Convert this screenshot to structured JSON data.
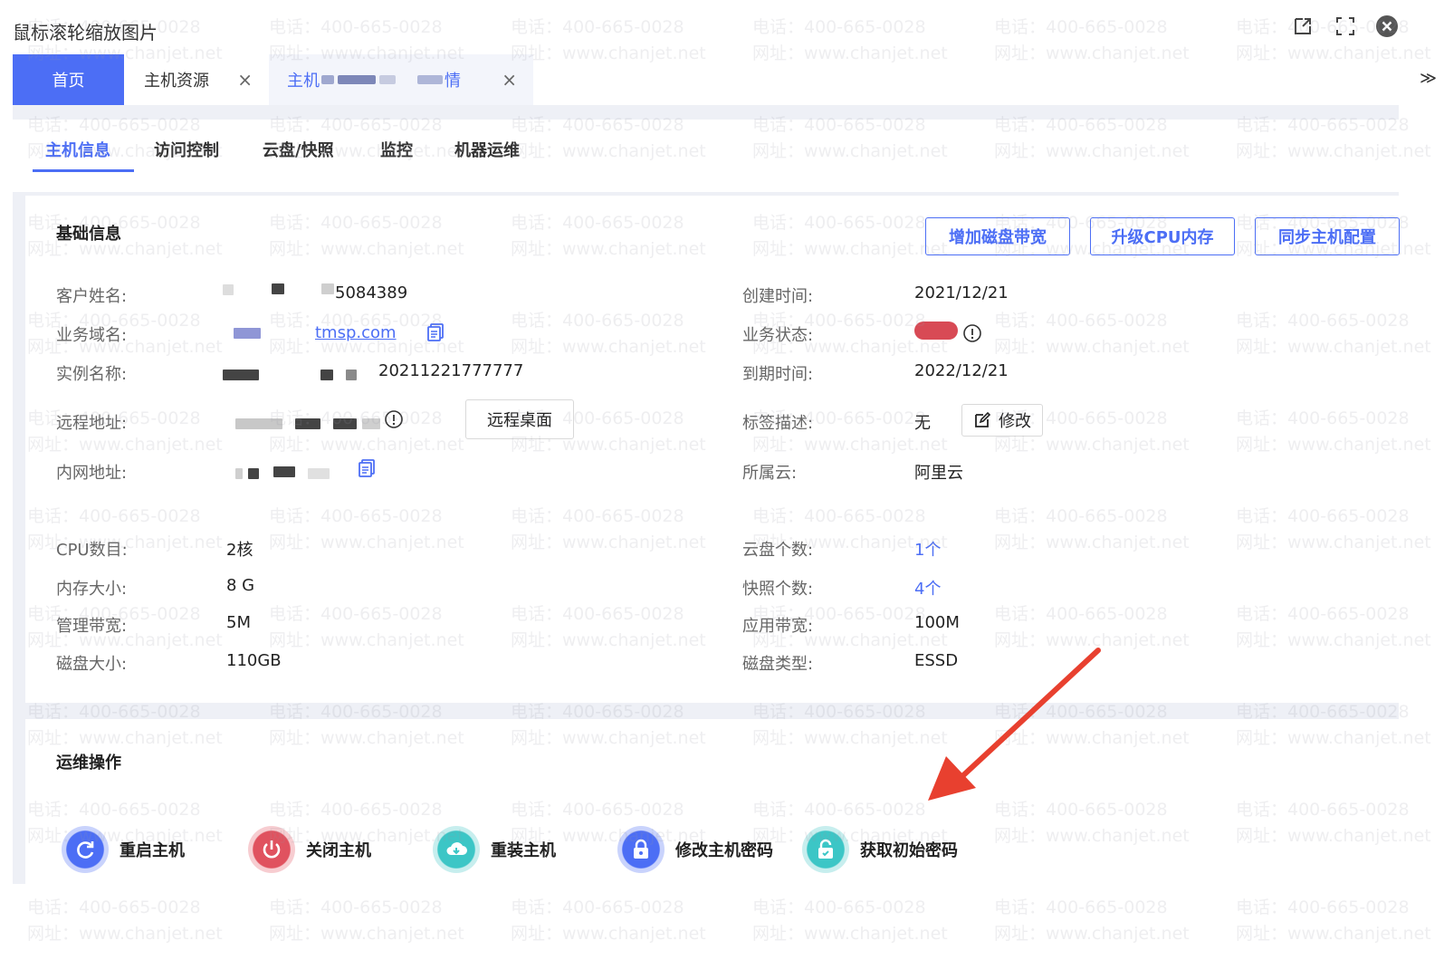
{
  "window": {
    "title": "鼠标滚轮缩放图片",
    "icons": [
      "external-link-icon",
      "fullscreen-icon",
      "close-icon"
    ]
  },
  "watermark": {
    "line1": "电话：400-665-0028",
    "line2": "网址：www.chanjet.net"
  },
  "tabs": {
    "home": "首页",
    "host_resources": "主机资源",
    "host_detail_prefix": "主机",
    "host_detail_suffix": "情",
    "close": "×",
    "overflow": "≫"
  },
  "subnav": {
    "items": [
      "主机信息",
      "访问控制",
      "云盘/快照",
      "监控",
      "机器运维"
    ],
    "active": 0
  },
  "basic": {
    "title": "基础信息",
    "buttons": {
      "add_disk_bandwidth": "增加磁盘带宽",
      "upgrade_cpu_memory": "升级CPU内存",
      "sync_host_config": "同步主机配置"
    },
    "customer_name": {
      "label": "客户姓名:",
      "value_suffix": "5084389"
    },
    "business_domain": {
      "label": "业务域名:",
      "value_suffix": "tmsp.com"
    },
    "instance_name": {
      "label": "实例名称:",
      "value_suffix": "20211221777777"
    },
    "remote_address": {
      "label": "远程地址:",
      "button": "远程桌面"
    },
    "intranet_address": {
      "label": "内网地址:"
    },
    "created_time": {
      "label": "创建时间:",
      "value": "2021/12/21"
    },
    "business_status": {
      "label": "业务状态:"
    },
    "expire_time": {
      "label": "到期时间:",
      "value": "2022/12/21"
    },
    "tag_desc": {
      "label": "标签描述:",
      "value": "无",
      "button": "修改"
    },
    "cloud": {
      "label": "所属云:",
      "value": "阿里云"
    },
    "cpu": {
      "label": "CPU数目:",
      "value": "2核"
    },
    "memory": {
      "label": "内存大小:",
      "value": "8 G"
    },
    "mgmt_bandwidth": {
      "label": "管理带宽:",
      "value": "5M"
    },
    "disk_size": {
      "label": "磁盘大小:",
      "value": "110GB"
    },
    "disk_count": {
      "label": "云盘个数:",
      "value": "1个"
    },
    "snapshot_count": {
      "label": "快照个数:",
      "value": "4个"
    },
    "app_bandwidth": {
      "label": "应用带宽:",
      "value": "100M"
    },
    "disk_type": {
      "label": "磁盘类型:",
      "value": "ESSD"
    }
  },
  "ops": {
    "title": "运维操作",
    "items": [
      {
        "label": "重启主机",
        "icon": "restart-icon",
        "color": "#4c6ef5"
      },
      {
        "label": "关闭主机",
        "icon": "power-icon",
        "color": "#e0525f"
      },
      {
        "label": "重装主机",
        "icon": "cloud-reinstall-icon",
        "color": "#3cc6c6"
      },
      {
        "label": "修改主机密码",
        "icon": "lock-icon",
        "color": "#4c6ef5"
      },
      {
        "label": "获取初始密码",
        "icon": "unlock-icon",
        "color": "#3cc6c6"
      }
    ]
  },
  "colors": {
    "accent": "#4c6ef5",
    "danger": "#e0525f",
    "teal": "#3cc6c6",
    "arrow": "#e8402f"
  }
}
